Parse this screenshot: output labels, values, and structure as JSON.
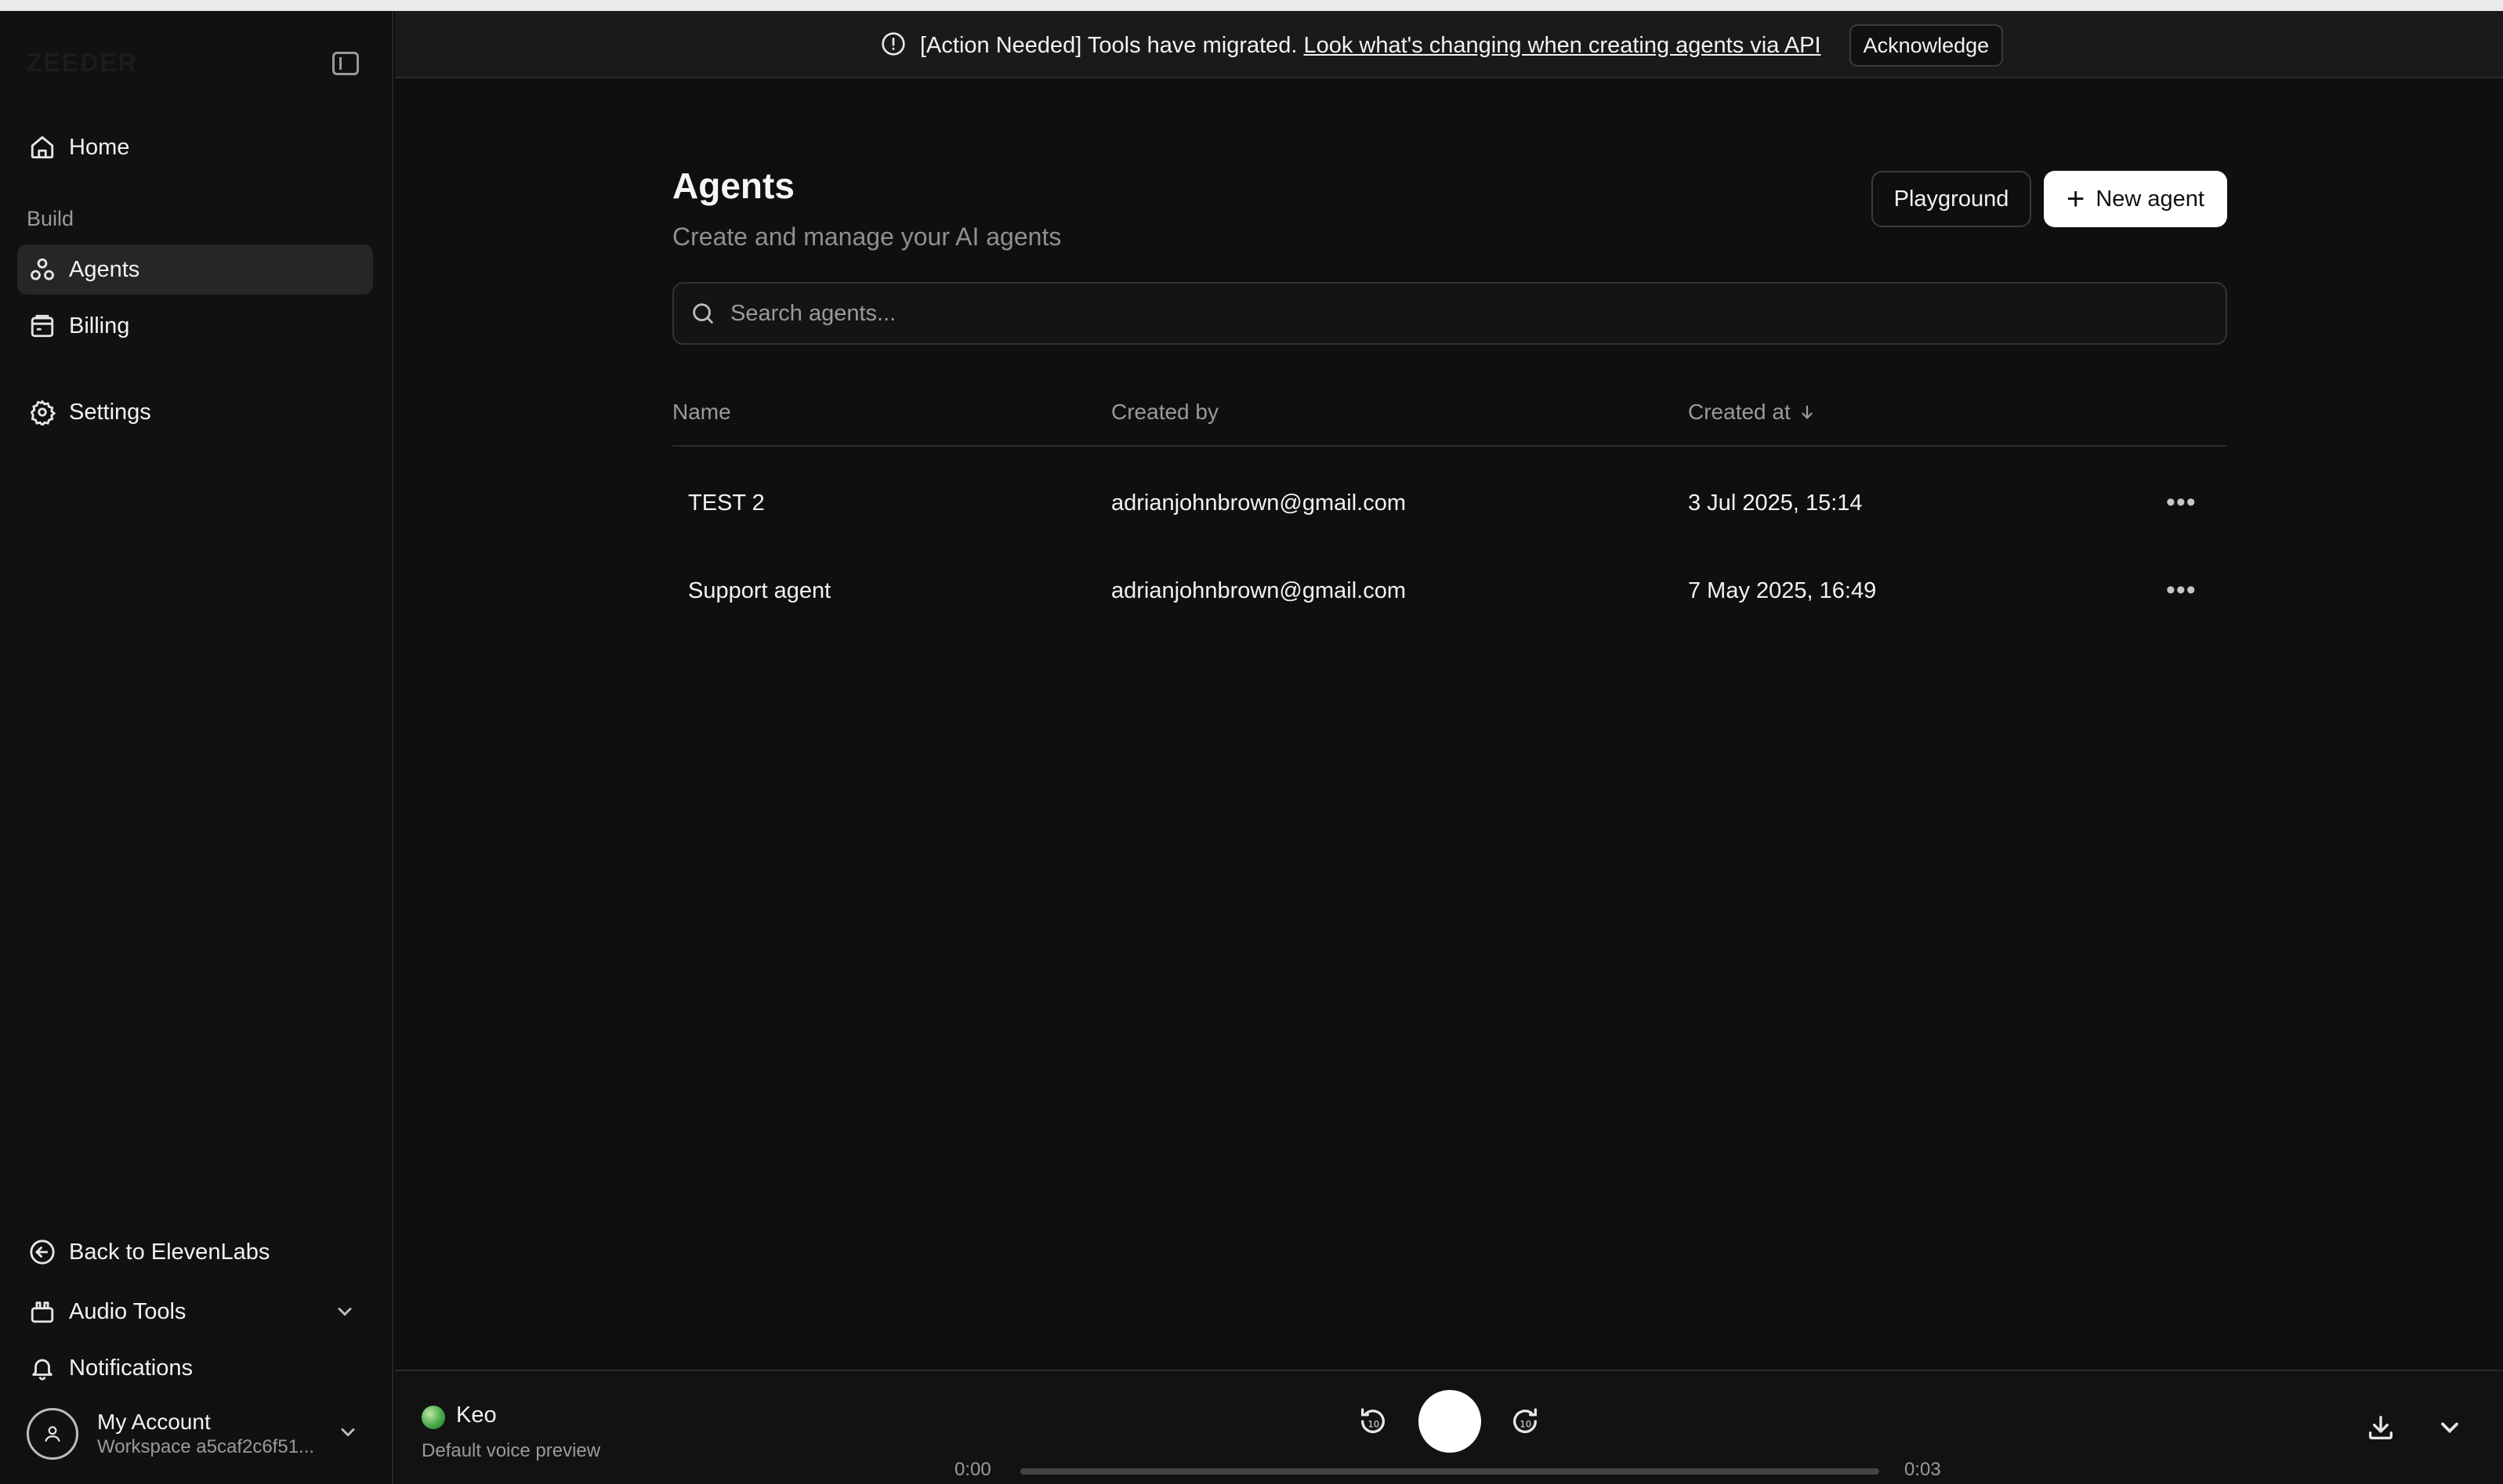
{
  "sidebar": {
    "logo": "ZEEDER",
    "home": "Home",
    "section_build": "Build",
    "agents": "Agents",
    "billing": "Billing",
    "settings": "Settings",
    "back": "Back to ElevenLabs",
    "audio_tools": "Audio Tools",
    "notifications": "Notifications",
    "account_name": "My Account",
    "account_workspace": "Workspace a5caf2c6f51..."
  },
  "banner": {
    "text": "[Action Needed] Tools have migrated.",
    "link": "Look what's changing when creating agents via API",
    "button": "Acknowledge"
  },
  "main": {
    "title": "Agents",
    "subtitle": "Create and manage your AI agents",
    "playground_label": "Playground",
    "new_agent_label": "New agent",
    "search_placeholder": "Search agents...",
    "columns": [
      "Name",
      "Created by",
      "Created at"
    ],
    "rows": [
      {
        "name": "TEST 2",
        "created_by": "adrianjohnbrown@gmail.com",
        "created_at": "3 Jul 2025, 15:14"
      },
      {
        "name": "Support agent",
        "created_by": "adrianjohnbrown@gmail.com",
        "created_at": "7 May 2025, 16:49"
      }
    ]
  },
  "player": {
    "voice_name": "Keo",
    "voice_sub": "Default voice preview",
    "time_current": "0:00",
    "time_total": "0:03",
    "progress": 0,
    "skip_back_label": "10",
    "skip_forward_label": "10"
  },
  "colors": {
    "background": "#0f0f0f",
    "sidebar": "#111111",
    "active_item": "#262626",
    "text": "#f2f2f2",
    "muted": "#9a9a9a",
    "primary_button": "#ffffff"
  }
}
